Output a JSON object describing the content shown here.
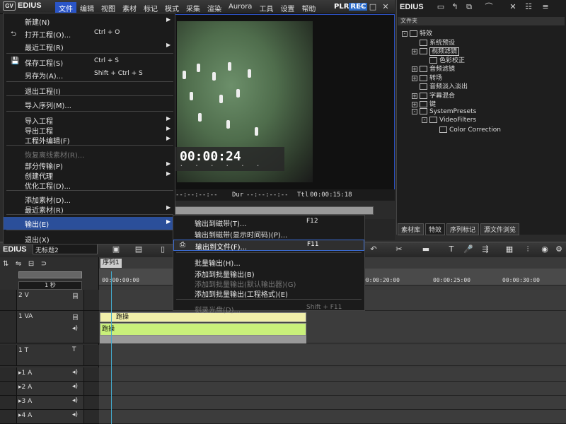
{
  "app": {
    "name": "EDIUS",
    "logo_mark": "GV"
  },
  "menubar": [
    {
      "label": "文件",
      "active": true
    },
    {
      "label": "编辑"
    },
    {
      "label": "视图"
    },
    {
      "label": "素材"
    },
    {
      "label": "标记"
    },
    {
      "label": "模式"
    },
    {
      "label": "采集"
    },
    {
      "label": "渲染"
    },
    {
      "label": "Aurora"
    },
    {
      "label": "工具"
    },
    {
      "label": "设置"
    },
    {
      "label": "帮助"
    }
  ],
  "preview": {
    "plr": "PLR",
    "rec": "REC",
    "timecode": "00:00:24",
    "in_tc": "--:--:--:--",
    "dur_label": "Dur",
    "dur_tc": "--:--:--:--",
    "ttl_label": "Ttl",
    "ttl_tc": "00:00:15:18"
  },
  "file_menu": {
    "items": [
      {
        "label": "新建(N)",
        "arrow": true
      },
      {
        "label": "打开工程(O)...",
        "shortcut": "Ctrl + O",
        "icon": "open-project-icon"
      },
      {
        "label": "最近工程(R)",
        "arrow": true
      },
      {
        "label": "保存工程(S)",
        "shortcut": "Ctrl + S",
        "icon": "save-icon"
      },
      {
        "label": "另存为(A)...",
        "shortcut": "Shift + Ctrl + S"
      },
      {
        "label": "退出工程(I)"
      },
      {
        "label": "导入序列(M)..."
      },
      {
        "label": "导入工程",
        "arrow": true
      },
      {
        "label": "导出工程",
        "arrow": true
      },
      {
        "label": "工程外编辑(F)",
        "arrow": true
      },
      {
        "label": "恢复离线素材(R)...",
        "disabled": true
      },
      {
        "label": "部分传输(P)",
        "arrow": true
      },
      {
        "label": "创建代理",
        "arrow": true
      },
      {
        "label": "优化工程(D)..."
      },
      {
        "label": "添加素材(D)..."
      },
      {
        "label": "最近素材(R)",
        "arrow": true
      },
      {
        "label": "输出(E)",
        "arrow": true,
        "highlighted": true
      },
      {
        "label": "退出(X)"
      }
    ]
  },
  "export_submenu": {
    "items": [
      {
        "label": "输出到磁带(T)...",
        "shortcut": "F12"
      },
      {
        "label": "输出到磁带(显示时间码)(P)..."
      },
      {
        "label": "输出到文件(F)...",
        "shortcut": "F11",
        "highlighted": true,
        "icon": "export-file-icon"
      },
      {
        "label": "批量输出(H)..."
      },
      {
        "label": "添加到批量输出(B)"
      },
      {
        "label": "添加到批量输出(默认输出器)(G)",
        "disabled": true
      },
      {
        "label": "添加到批量输出(工程格式)(E)"
      },
      {
        "label": "刻录光盘(D)...",
        "shortcut": "Shift + F11",
        "disabled": true
      }
    ]
  },
  "right_panel": {
    "title": "EDIUS",
    "subtitle": "文件夹",
    "tree": [
      {
        "label": "特效",
        "level": 0,
        "expander": "-"
      },
      {
        "label": "系统预设",
        "level": 1
      },
      {
        "label": "视频滤镜",
        "level": 1,
        "expander": "+",
        "selected": true
      },
      {
        "label": "色彩校正",
        "level": 2
      },
      {
        "label": "音频滤镜",
        "level": 1,
        "expander": "+"
      },
      {
        "label": "转场",
        "level": 1,
        "expander": "+"
      },
      {
        "label": "音频淡入淡出",
        "level": 1
      },
      {
        "label": "字幕混合",
        "level": 1,
        "expander": "+"
      },
      {
        "label": "键",
        "level": 1,
        "expander": "+"
      },
      {
        "label": "SystemPresets",
        "level": 1,
        "expander": "-"
      },
      {
        "label": "VideoFilters",
        "level": 2,
        "expander": "-"
      },
      {
        "label": "Color Correction",
        "level": 3
      }
    ],
    "tabs": [
      "素材库",
      "特效",
      "序列标记",
      "源文件浏览"
    ],
    "active_tab": 1
  },
  "timeline": {
    "project_name": "无标题2",
    "sequence_tab": "序列1",
    "scale": "1 秒",
    "ruler_ticks": [
      "00:00:00:00",
      "00:00:20:00",
      "00:00:25:00",
      "00:00:30:00"
    ],
    "tracks": [
      {
        "name": "2 V"
      },
      {
        "name": "1 VA"
      },
      {
        "name": "1 T",
        "icon": "T"
      },
      {
        "name": "▸1 A"
      },
      {
        "name": "▸2 A"
      },
      {
        "name": "▸3 A"
      },
      {
        "name": "▸4 A"
      }
    ],
    "clip_video": "跑操",
    "clip_audio": "跑操"
  }
}
